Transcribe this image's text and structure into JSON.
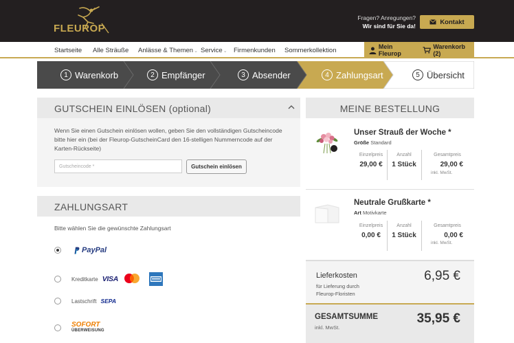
{
  "header": {
    "logo_text": "FLEUROP",
    "help_question": "Fragen? Anregungen?",
    "help_answer": "Wir sind für Sie da!",
    "contact_label": "Kontakt"
  },
  "nav": {
    "items": [
      {
        "label": "Startseite"
      },
      {
        "label": "Alle Sträuße"
      },
      {
        "label": "Anlässe & Themen"
      },
      {
        "label": "Service"
      },
      {
        "label": "Firmenkunden"
      },
      {
        "label": "Sommerkollektion"
      }
    ],
    "account_label": "Mein Fleurop",
    "cart_label": "Warenkorb (2)"
  },
  "steps": [
    {
      "num": "1",
      "label": "Warenkorb"
    },
    {
      "num": "2",
      "label": "Empfänger"
    },
    {
      "num": "3",
      "label": "Absender"
    },
    {
      "num": "4",
      "label": "Zahlungsart"
    },
    {
      "num": "5",
      "label": "Übersicht"
    }
  ],
  "voucher": {
    "title": "GUTSCHEIN EINLÖSEN (optional)",
    "text": "Wenn Sie einen Gutschein einlösen wollen, geben Sie den vollständigen Gutscheincode bitte hier ein (bei der Fleurop-GutscheinCard den 16-stelligen Nummerncode auf der Karten-Rückseite)",
    "input_placeholder": "Gutscheincode *",
    "button_label": "Gutschein einlösen"
  },
  "payment": {
    "title": "ZAHLUNGSART",
    "subtitle": "Bitte wählen Sie die gewünschte Zahlungsart",
    "options": [
      {
        "label": "PayPal",
        "selected": true
      },
      {
        "label": "Kreditkarte",
        "selected": false
      },
      {
        "label": "Lastschrift",
        "selected": false
      },
      {
        "label": "SOFORT ÜBERWEISUNG",
        "selected": false
      }
    ],
    "card_brands": [
      "VISA",
      "Mastercard",
      "American Express"
    ],
    "sepa_label": "SEPA",
    "sofort_top": "SOFORT",
    "sofort_bottom": "ÜBERWEISUNG"
  },
  "order": {
    "title": "MEINE BESTELLUNG",
    "items": [
      {
        "title": "Unser Strauß der Woche *",
        "attr_label": "Größe",
        "attr_value": "Standard",
        "unit_price_label": "Einzelpreis",
        "unit_price": "29,00 €",
        "qty_label": "Anzahl",
        "qty": "1 Stück",
        "total_label": "Gesamtpreis",
        "total": "29,00 €",
        "tax_note": "inkl. MwSt."
      },
      {
        "title": "Neutrale Grußkarte *",
        "attr_label": "Art",
        "attr_value": "Motivkarte",
        "unit_price_label": "Einzelpreis",
        "unit_price": "0,00 €",
        "qty_label": "Anzahl",
        "qty": "1 Stück",
        "total_label": "Gesamtpreis",
        "total": "0,00 €",
        "tax_note": "inkl. MwSt."
      }
    ],
    "delivery": {
      "label": "Lieferkosten",
      "note_line1": "für Lieferung durch",
      "note_line2": "Fleurop-Floristen",
      "amount": "6,95 €"
    },
    "total": {
      "label": "GESAMTSUMME",
      "tax_note": "inkl. MwSt.",
      "amount": "35,95 €"
    }
  },
  "colors": {
    "gold": "#c8a951",
    "dark": "#231f20",
    "step_done": "#4a4a4a"
  }
}
